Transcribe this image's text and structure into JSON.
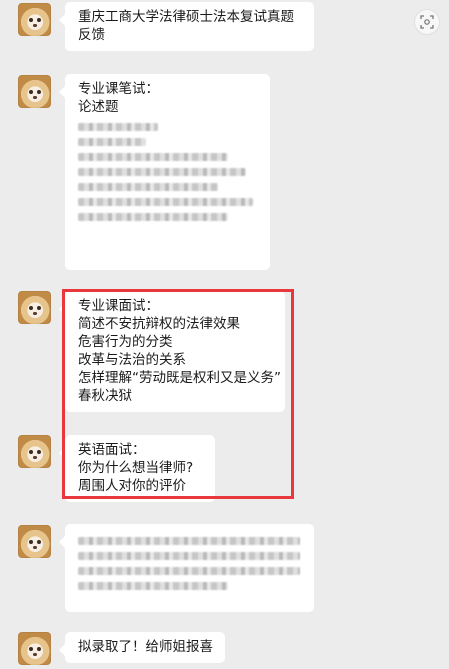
{
  "messages": [
    {
      "lines": [
        "重庆工商大学法律硕士法本复试真题",
        "反馈"
      ]
    },
    {
      "lines": [
        "专业课笔试：",
        "论述题"
      ],
      "blurred_lines": 7
    },
    {
      "lines": [
        "专业课面试：",
        "简述不安抗辩权的法律效果",
        "危害行为的分类",
        "改革与法治的关系",
        "怎样理解“劳动既是权利又是义务”",
        "春秋决狱"
      ]
    },
    {
      "lines": [
        "英语面试：",
        "你为什么想当律师?",
        "周围人对你的评价"
      ]
    },
    {
      "blurred_lines": 4
    },
    {
      "lines": [
        "拟录取了！给师姐报喜"
      ]
    }
  ],
  "highlight_color": "#e8383d",
  "side_icon": "screenshot-icon"
}
